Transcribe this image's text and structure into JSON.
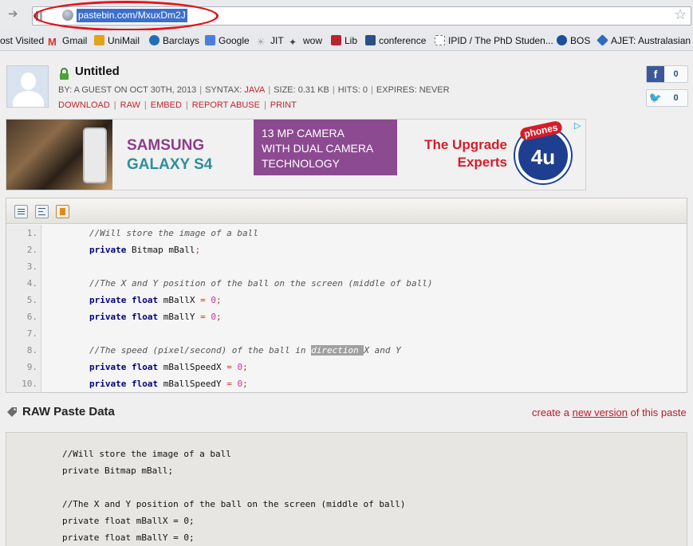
{
  "browser": {
    "url": "pastebin.com/MxuxDm2J",
    "bookmarks": [
      {
        "label": "ost Visited",
        "icon": "none"
      },
      {
        "label": "Gmail",
        "icon": "gmail-icon",
        "color": "#d93025"
      },
      {
        "label": "UniMail",
        "icon": "unimail-icon",
        "color": "#e2a21a"
      },
      {
        "label": "Barclays",
        "icon": "barclays-icon",
        "color": "#1f6fb5"
      },
      {
        "label": "Google",
        "icon": "google-icon",
        "color": "#4a7fe0"
      },
      {
        "label": "JIT",
        "icon": "jit-icon",
        "color": "#c0c0c0"
      },
      {
        "label": "wow",
        "icon": "wow-icon",
        "color": "#555555"
      },
      {
        "label": "Lib",
        "icon": "lib-icon",
        "color": "#b8232f"
      },
      {
        "label": "conference",
        "icon": "conference-icon",
        "color": "#2a4f8a"
      },
      {
        "label": "IPID / The PhD Studen...",
        "icon": "page-icon",
        "color": "#ffffff"
      },
      {
        "label": "BOS",
        "icon": "bos-icon",
        "color": "#1c4fa0"
      },
      {
        "label": "AJET: Australasian J...",
        "icon": "ajet-icon",
        "color": "#2e6cc0"
      }
    ]
  },
  "paste": {
    "title": "Untitled",
    "meta": {
      "by": "BY: A GUEST ON OCT 30TH, 2013",
      "syntax_label": "SYNTAX:",
      "syntax": "JAVA",
      "size": "SIZE: 0.31 KB",
      "hits": "HITS: 0",
      "expires": "EXPIRES: NEVER",
      "sep": "|"
    },
    "actions": [
      "DOWNLOAD",
      "RAW",
      "EMBED",
      "REPORT ABUSE",
      "PRINT"
    ],
    "social": {
      "facebook_count": "0",
      "twitter_count": "0",
      "facebook_glyph": "f",
      "twitter_glyph": "🐦"
    }
  },
  "ad": {
    "brand_line1": "SAMSUNG",
    "brand_line2": "GALAXY S4",
    "box_lines": [
      "13 MP CAMERA",
      "WITH DUAL CAMERA",
      "TECHNOLOGY"
    ],
    "tagline_line1": "The Upgrade",
    "tagline_line2": "Experts",
    "logo_top": "phones",
    "logo_main": "4u",
    "colors": {
      "purple": "#8c4a91",
      "teal": "#2e8f9a",
      "red": "#d61c2a",
      "navy": "#1e3f8f"
    }
  },
  "code": {
    "lines": [
      {
        "num": "1.",
        "parts": [
          {
            "t": "//Will store the image of a ball",
            "c": "cm"
          }
        ]
      },
      {
        "num": "2.",
        "parts": [
          {
            "t": "private",
            "c": "kw"
          },
          {
            "t": " Bitmap mBall",
            "c": ""
          },
          {
            "t": ";",
            "c": "op"
          }
        ]
      },
      {
        "num": "3.",
        "parts": []
      },
      {
        "num": "4.",
        "parts": [
          {
            "t": "//The X and Y position of the ball on the screen (middle of ball)",
            "c": "cm"
          }
        ]
      },
      {
        "num": "5.",
        "parts": [
          {
            "t": "private",
            "c": "kw"
          },
          {
            "t": " ",
            "c": ""
          },
          {
            "t": "float",
            "c": "kw"
          },
          {
            "t": " mBallX ",
            "c": ""
          },
          {
            "t": "=",
            "c": "op"
          },
          {
            "t": " ",
            "c": ""
          },
          {
            "t": "0",
            "c": "nm"
          },
          {
            "t": ";",
            "c": "op"
          }
        ]
      },
      {
        "num": "6.",
        "parts": [
          {
            "t": "private",
            "c": "kw"
          },
          {
            "t": " ",
            "c": ""
          },
          {
            "t": "float",
            "c": "kw"
          },
          {
            "t": " mBallY ",
            "c": ""
          },
          {
            "t": "=",
            "c": "op"
          },
          {
            "t": " ",
            "c": ""
          },
          {
            "t": "0",
            "c": "nm"
          },
          {
            "t": ";",
            "c": "op"
          }
        ]
      },
      {
        "num": "7.",
        "parts": []
      },
      {
        "num": "8.",
        "parts": [
          {
            "t": "//The speed (pixel/second) of the ball in ",
            "c": "cm"
          },
          {
            "t": "direction ",
            "c": "cm sel"
          },
          {
            "t": "X and Y",
            "c": "cm"
          }
        ]
      },
      {
        "num": "9.",
        "parts": [
          {
            "t": "private",
            "c": "kw"
          },
          {
            "t": " ",
            "c": ""
          },
          {
            "t": "float",
            "c": "kw"
          },
          {
            "t": " mBallSpeedX ",
            "c": ""
          },
          {
            "t": "=",
            "c": "op"
          },
          {
            "t": " ",
            "c": ""
          },
          {
            "t": "0",
            "c": "nm"
          },
          {
            "t": ";",
            "c": "op"
          }
        ]
      },
      {
        "num": "10.",
        "parts": [
          {
            "t": "private",
            "c": "kw"
          },
          {
            "t": " ",
            "c": ""
          },
          {
            "t": "float",
            "c": "kw"
          },
          {
            "t": " mBallSpeedY ",
            "c": ""
          },
          {
            "t": "=",
            "c": "op"
          },
          {
            "t": " ",
            "c": ""
          },
          {
            "t": "0",
            "c": "nm"
          },
          {
            "t": ";",
            "c": "op"
          }
        ]
      }
    ]
  },
  "raw": {
    "title": "RAW Paste Data",
    "link_prefix": "create a",
    "link_text": "new version",
    "link_suffix": "of this paste",
    "lines": [
      "//Will store the image of a ball",
      "private Bitmap mBall;",
      "",
      "//The X and Y position of the ball on the screen (middle of ball)",
      "private float mBallX = 0;",
      "private float mBallY = 0;"
    ]
  }
}
